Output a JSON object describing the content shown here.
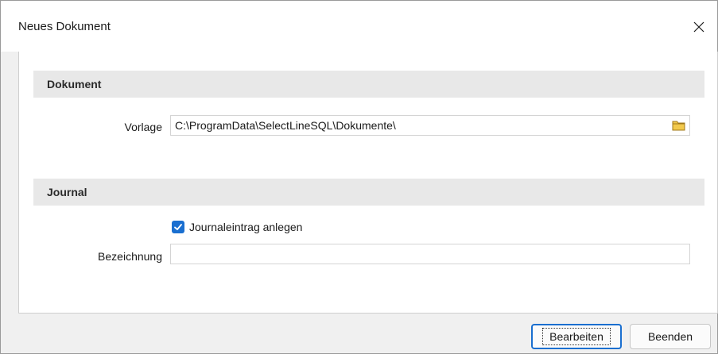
{
  "window": {
    "title": "Neues Dokument"
  },
  "dokument_section": {
    "header": "Dokument",
    "vorlage_label": "Vorlage",
    "vorlage_value": "C:\\ProgramData\\SelectLineSQL\\Dokumente\\"
  },
  "journal_section": {
    "header": "Journal",
    "checkbox_label": "Journaleintrag anlegen",
    "checkbox_checked": true,
    "bezeichnung_label": "Bezeichnung",
    "bezeichnung_value": ""
  },
  "buttons": {
    "edit_label": "Bearbeiten",
    "close_label": "Beenden"
  },
  "colors": {
    "accent": "#1a6fd0",
    "section_header_bg": "#e8e8e8",
    "folder_icon": "#f2c94c"
  },
  "icons": {
    "close": "close-icon",
    "folder": "folder-icon",
    "checkmark": "checkmark-icon"
  }
}
